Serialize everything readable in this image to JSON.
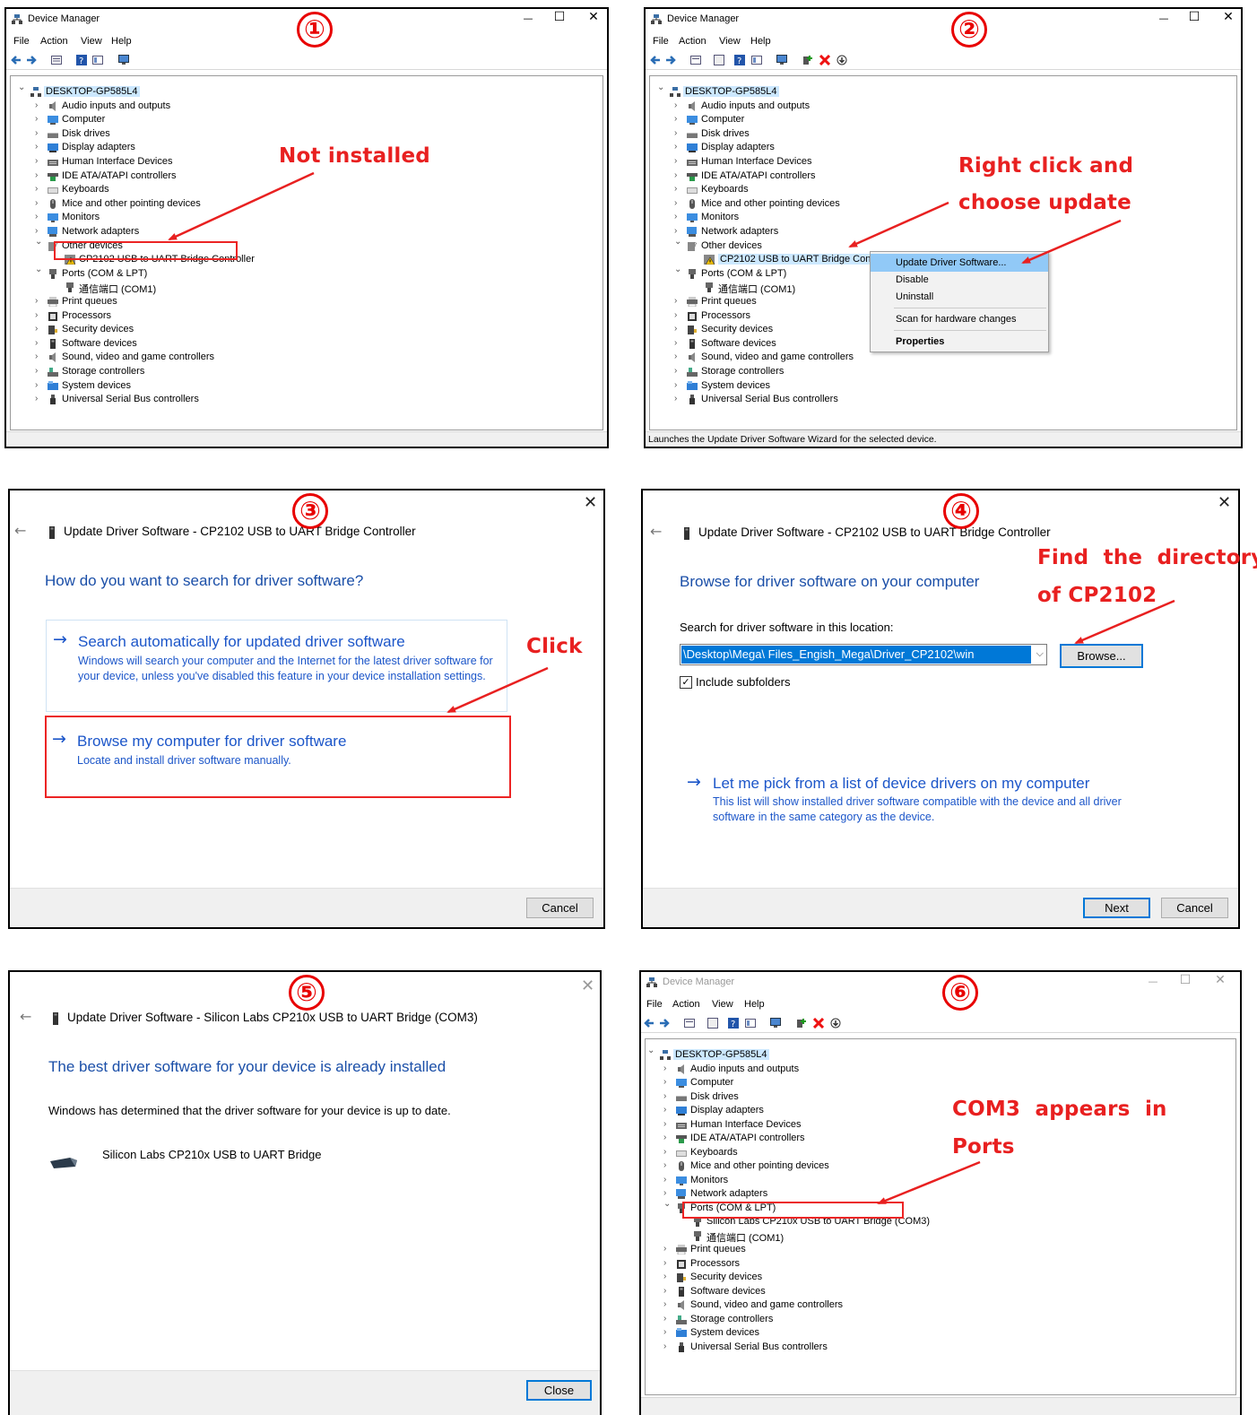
{
  "device_manager": {
    "title": "Device Manager",
    "menu": [
      "File",
      "Action",
      "View",
      "Help"
    ],
    "window_controls": {
      "minimize": "—",
      "maximize": "☐",
      "close": "✕"
    },
    "root": "DESKTOP-GP585L4",
    "categories": {
      "audio": "Audio inputs and outputs",
      "computer": "Computer",
      "disk": "Disk drives",
      "display": "Display adapters",
      "hid": "Human Interface Devices",
      "ide": "IDE ATA/ATAPI controllers",
      "keyboards": "Keyboards",
      "mice": "Mice and other pointing devices",
      "monitors": "Monitors",
      "network": "Network adapters",
      "other": "Other devices",
      "ports": "Ports (COM & LPT)",
      "print": "Print queues",
      "processors": "Processors",
      "security": "Security devices",
      "software": "Software devices",
      "sound": "Sound, video and game controllers",
      "storage": "Storage controllers",
      "system": "System devices",
      "usb": "Universal Serial Bus controllers"
    },
    "other_device": "CP2102 USB to UART Bridge Controller",
    "com1": "通信端口 (COM1)",
    "com3": "Silicon Labs CP210x USB to UART Bridge (COM3)"
  },
  "context_menu": {
    "update": "Update Driver Software...",
    "disable": "Disable",
    "uninstall": "Uninstall",
    "scan": "Scan for hardware changes",
    "properties": "Properties"
  },
  "status_text": "Launches the Update Driver Software Wizard for the selected device.",
  "steps": [
    "①",
    "②",
    "③",
    "④",
    "⑤",
    "⑥"
  ],
  "annotations": {
    "a1": "Not installed",
    "a2_line1": "Right click and",
    "a2_line2": "choose update",
    "a3": "Click",
    "a4_line1": "Find  the  directory",
    "a4_line2": "of CP2102",
    "a6_line1": "COM3  appears  in",
    "a6_line2": "Ports"
  },
  "dialog3": {
    "title": "Update Driver Software - CP2102 USB to UART Bridge Controller",
    "heading": "How do you want to search for driver software?",
    "opt1_title": "Search automatically for updated driver software",
    "opt1_desc": "Windows will search your computer and the Internet for the latest driver software for your device, unless you've disabled this feature in your device installation settings.",
    "opt2_title": "Browse my computer for driver software",
    "opt2_desc": "Locate and install driver software manually.",
    "cancel": "Cancel"
  },
  "dialog4": {
    "title": "Update Driver Software - CP2102 USB to UART Bridge Controller",
    "heading": "Browse for driver software on your computer",
    "search_label": "Search for driver software in this location:",
    "path": "\\Desktop\\Mega\\ Files_Engish_Mega\\Driver_CP2102\\win",
    "browse": "Browse...",
    "include_subfolders": "Include subfolders",
    "pick_title": "Let me pick from a list of device drivers on my computer",
    "pick_desc": "This list will show installed driver software compatible with the device and all driver software in the same category as the device.",
    "next": "Next",
    "cancel": "Cancel"
  },
  "dialog5": {
    "title": "Update Driver Software - Silicon Labs CP210x USB to UART Bridge (COM3)",
    "heading": "The best driver software for your device is already installed",
    "message": "Windows has determined that the driver software for your device is up to date.",
    "device": "Silicon Labs CP210x USB to UART Bridge",
    "close": "Close"
  },
  "colors": {
    "annotation": "#e82020",
    "link": "#1c56c9",
    "heading": "#1b4fa8",
    "selection": "#0078d7"
  }
}
